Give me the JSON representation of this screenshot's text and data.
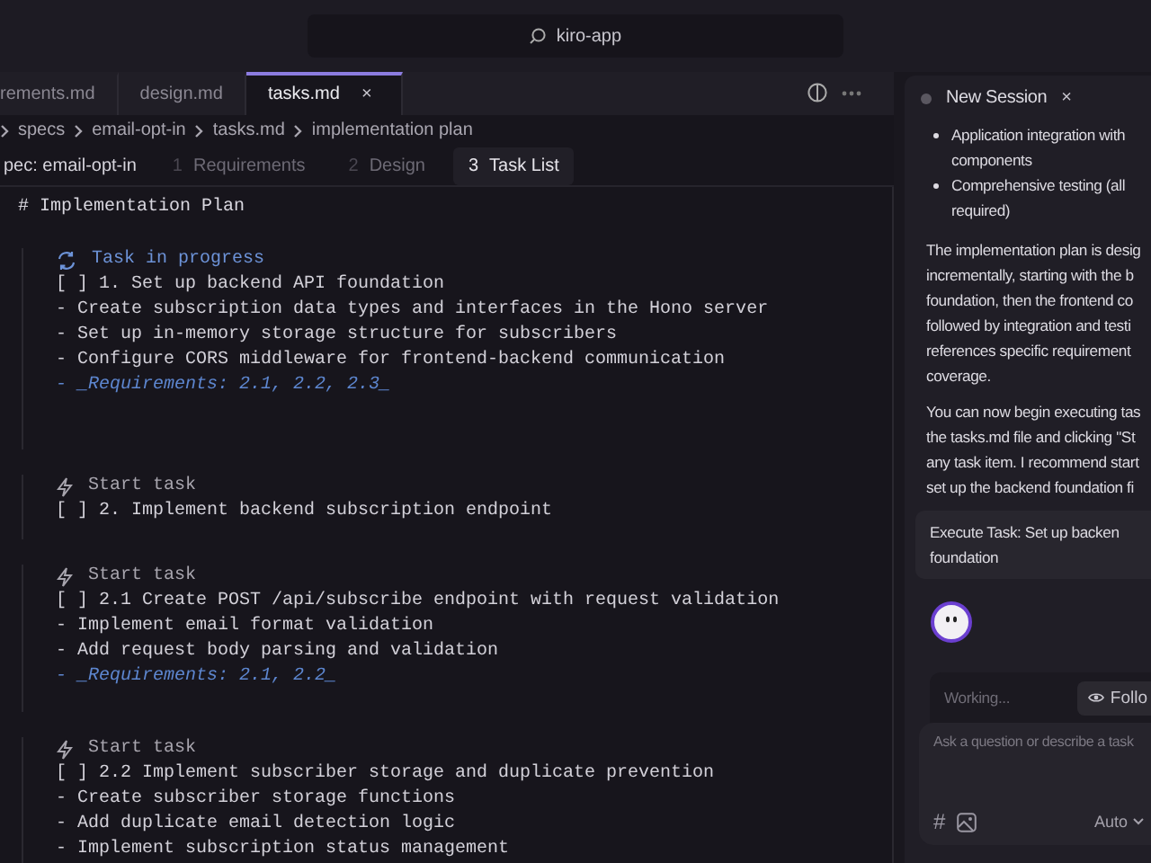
{
  "title_bar": {
    "search": "kiro-app"
  },
  "tabs": [
    {
      "label": "rements.md",
      "selected": false
    },
    {
      "label": "design.md",
      "selected": false
    },
    {
      "label": "tasks.md",
      "selected": true,
      "close": "×"
    }
  ],
  "breadcrumb": [
    "specs",
    "email-opt-in",
    "tasks.md",
    "implementation plan"
  ],
  "spec_bar": {
    "label": "pec: email-opt-in",
    "steps": [
      {
        "number": "1",
        "label": "Requirements",
        "selected": false
      },
      {
        "number": "2",
        "label": "Design",
        "selected": false
      },
      {
        "number": "3",
        "label": "Task List",
        "selected": true
      }
    ]
  },
  "editor": {
    "heading": "# Implementation Plan",
    "blocks": [
      {
        "kind": "in_progress",
        "action": "Task in progress",
        "lines": [
          {
            "kind": "task",
            "text": "[ ] 1. Set up backend API foundation"
          },
          {
            "kind": "item",
            "text": "- Create subscription data types and interfaces in the Hono server"
          },
          {
            "kind": "item",
            "text": "- Set up in-memory storage structure for subscribers"
          },
          {
            "kind": "item",
            "text": "- Configure CORS middleware for frontend-backend communication"
          },
          {
            "kind": "requirement",
            "text": "- _Requirements: 2.1, 2.2, 2.3_"
          }
        ]
      },
      {
        "kind": "start",
        "action": "Start task",
        "lines": [
          {
            "kind": "task",
            "text": "[ ] 2. Implement backend subscription endpoint"
          }
        ]
      },
      {
        "kind": "start",
        "action": "Start task",
        "lines": [
          {
            "kind": "task",
            "text": "[ ] 2.1 Create POST /api/subscribe endpoint with request validation"
          },
          {
            "kind": "item",
            "text": "- Implement email format validation"
          },
          {
            "kind": "item",
            "text": "- Add request body parsing and validation"
          },
          {
            "kind": "requirement",
            "text": "- _Requirements: 2.1, 2.2_"
          }
        ]
      },
      {
        "kind": "start",
        "action": "Start task",
        "lines": [
          {
            "kind": "task",
            "text": "[ ] 2.2 Implement subscriber storage and duplicate prevention"
          },
          {
            "kind": "item",
            "text": "- Create subscriber storage functions"
          },
          {
            "kind": "item",
            "text": "- Add duplicate email detection logic"
          },
          {
            "kind": "item",
            "text": "- Implement subscription status management"
          }
        ]
      }
    ]
  },
  "chat": {
    "tab": "New Session",
    "close": "×",
    "bullets": [
      [
        "Application integration with",
        "components"
      ],
      [
        "Comprehensive testing (all",
        "required)"
      ]
    ],
    "paragraphs": [
      [
        "The implementation plan is desig",
        "incrementally, starting with the b",
        "foundation, then the frontend co",
        "followed by integration and testi",
        "references specific requirement",
        "coverage."
      ],
      [
        "You can now begin executing tas",
        "the tasks.md file and clicking \"St",
        "any task item. I recommend start",
        "set up the backend foundation fi"
      ]
    ],
    "command": [
      "Execute Task: Set up backen",
      "foundation"
    ],
    "status": "Working...",
    "follow": "Follo",
    "input": {
      "placeholder": "Ask a question or describe a task"
    },
    "hash": "#",
    "mode": "Auto"
  }
}
